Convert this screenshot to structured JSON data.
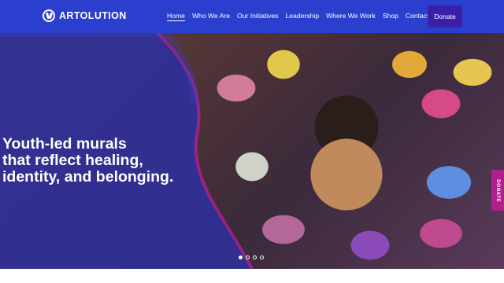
{
  "header": {
    "logo_text": "ARTOLUTION",
    "nav": [
      {
        "label": "Home",
        "active": true
      },
      {
        "label": "Who We Are"
      },
      {
        "label": "Our Initiatives"
      },
      {
        "label": "Leadership"
      },
      {
        "label": "Where We Work"
      },
      {
        "label": "Shop"
      },
      {
        "label": "Contact Us"
      }
    ],
    "donate_label": "Donate"
  },
  "hero": {
    "headline_lines": [
      "Youth-led murals",
      "that reflect healing,",
      "identity, and belonging."
    ],
    "slides_total": 4,
    "slide_active": 1,
    "side_tab_label": "DONATE"
  },
  "colors": {
    "header_bg": "#2b3fcf",
    "hero_panel": "#2f2f97",
    "accent_pink": "#b01f8e",
    "donate_bg": "#3a1fa8"
  }
}
